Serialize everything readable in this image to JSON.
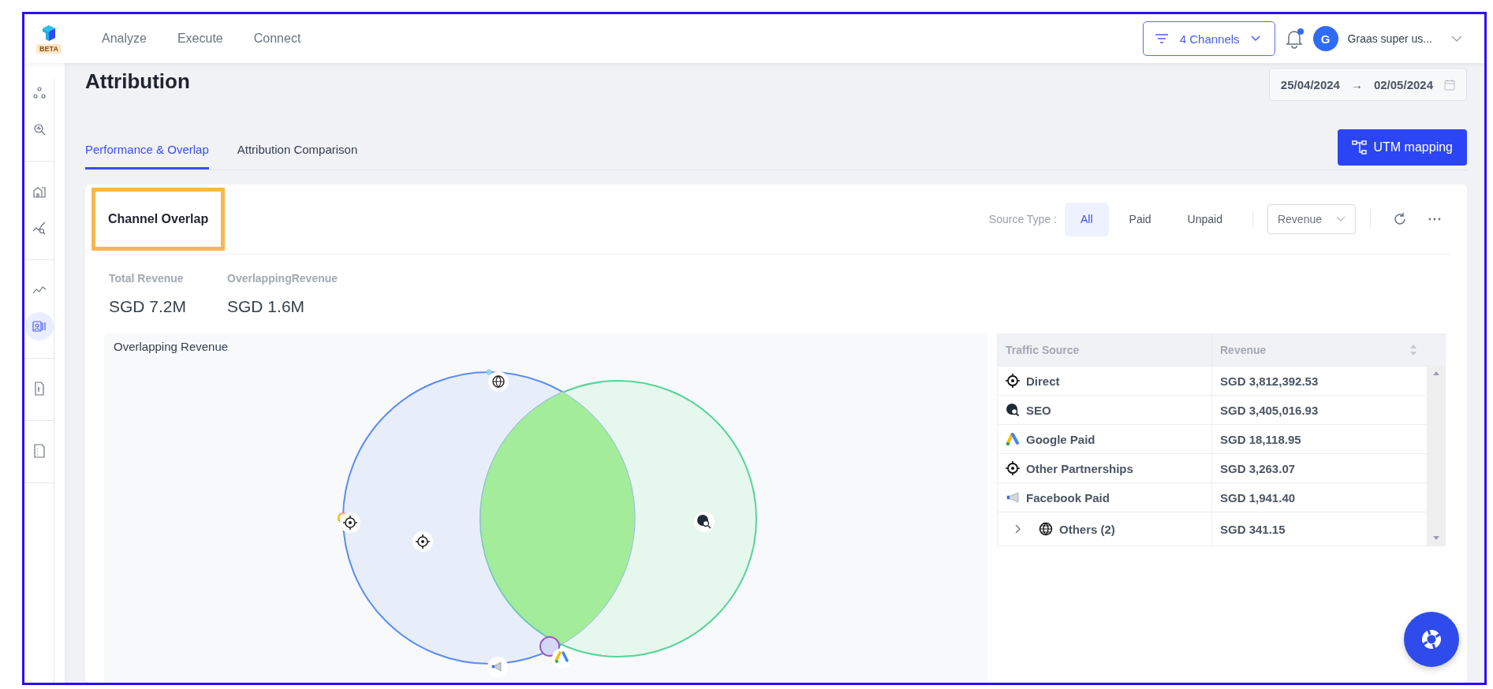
{
  "nav": {
    "badge": "BETA",
    "items": [
      {
        "label": "Analyze"
      },
      {
        "label": "Execute"
      },
      {
        "label": "Connect"
      }
    ]
  },
  "channels_filter": "4 Channels",
  "notifications": {
    "unread": true
  },
  "user": {
    "initial": "G",
    "name": "Graas super us..."
  },
  "sidebar": {
    "groups": [
      {
        "items": [
          {
            "kind": "nodes",
            "selected": false
          },
          {
            "kind": "search",
            "selected": false
          }
        ]
      },
      {
        "items": [
          {
            "kind": "store",
            "selected": false
          },
          {
            "kind": "trend-search",
            "selected": false
          }
        ]
      },
      {
        "items": [
          {
            "kind": "line",
            "selected": false
          },
          {
            "kind": "attribution",
            "selected": true
          }
        ]
      },
      {
        "items": [
          {
            "kind": "doc",
            "selected": false
          }
        ]
      },
      {
        "items": [
          {
            "kind": "sheet",
            "selected": false
          }
        ]
      }
    ]
  },
  "page_title": "Attribution",
  "date_range": {
    "start": "25/04/2024",
    "separator": "→",
    "end": "02/05/2024"
  },
  "tabs": [
    {
      "label": "Performance & Overlap",
      "selected": true
    },
    {
      "label": "Attribution Comparison",
      "selected": false
    }
  ],
  "utm_button": "UTM mapping",
  "card": {
    "title": "Channel Overlap",
    "highlighted": true,
    "source_type_label": "Source Type :",
    "source_types": [
      {
        "label": "All",
        "selected": true
      },
      {
        "label": "Paid",
        "selected": false
      },
      {
        "label": "Unpaid",
        "selected": false
      }
    ],
    "metric_select": "Revenue",
    "stats": [
      {
        "label": "Total Revenue",
        "value": "SGD 7.2M"
      },
      {
        "label": "OverlappingRevenue",
        "value": "SGD 1.6M"
      }
    ],
    "venn": {
      "title": "Overlapping Revenue"
    },
    "table": {
      "columns": [
        "Traffic Source",
        "Revenue"
      ],
      "rows": [
        {
          "kind": "target",
          "source": "Direct",
          "revenue": "SGD 3,812,392.53"
        },
        {
          "kind": "seo",
          "source": "SEO",
          "revenue": "SGD 3,405,016.93"
        },
        {
          "kind": "google",
          "source": "Google Paid",
          "revenue": "SGD 18,118.95"
        },
        {
          "kind": "target",
          "source": "Other Partnerships",
          "revenue": "SGD 3,263.07"
        },
        {
          "kind": "megaphone",
          "source": "Facebook Paid",
          "revenue": "SGD 1,941.40"
        },
        {
          "kind": "globe",
          "source": "Others (2)",
          "revenue": "SGD 341.15",
          "expanded": false
        }
      ]
    }
  }
}
